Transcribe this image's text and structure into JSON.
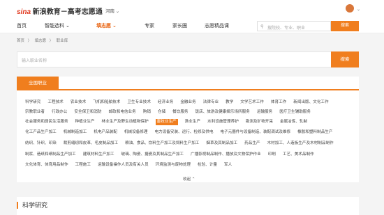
{
  "header": {
    "logo_brand": "sina",
    "logo_text": "新浪教育－高考志愿通",
    "region": "河南 ⌄"
  },
  "nav": {
    "items": [
      "首页",
      "智能选科 ⌄",
      "填志愿 ⌄",
      "专家",
      "家长圈",
      "志愿精品课"
    ],
    "active_index": 2
  },
  "search_mini": {
    "placeholder": "搜院校、专业、职业",
    "button": "搜索"
  },
  "breadcrumb": [
    "首页",
    "〉",
    "填志愿",
    "〉",
    "职业库"
  ],
  "search": {
    "placeholder": "输入职业名称",
    "button": "搜索"
  },
  "tabs": {
    "active": "全国职业"
  },
  "rows": [
    [
      "科学研究",
      "工程技术",
      "农业技术",
      "飞机和船舶技术",
      "卫生专业技术",
      "经济业务",
      "金融业务",
      "法律专业",
      "教学",
      "文学艺术工作",
      "体育工作",
      "新闻出版、文化工作"
    ],
    [
      "宗教职业者",
      "行政办公",
      "安全保卫和消防",
      "邮政和电信业务",
      "购销",
      "仓储",
      "餐饮服务",
      "饭店、旅游及健康娱乐场所服务",
      "运输服务",
      "医疗卫生辅助服务"
    ],
    [
      "社会服务和居民生活服务",
      "种植业生产",
      "林业生产及野生动植物保护",
      "畜牧业生产",
      "渔业生产",
      "水利设施管理养护",
      "勘测及矿物开采",
      "金属冶炼、轧制"
    ],
    [
      "化工产品生产加工",
      "机械制造加工",
      "机电产品装配",
      "机械设备修理",
      "电力设备安装、运行、检修及供电",
      "电子元器件与设备制造、装配调试及维修",
      "橡胶和塑料制品生产"
    ],
    [
      "纺织、针织、印染",
      "裁剪缝纫和皮革、毛皮制品加工",
      "粮油、食品、饮料生产加工及饲料生产加工",
      "烟草及其制品加工",
      "药品生产",
      "木材加工、人造板生产及木材制品制作"
    ],
    [
      "制浆、造纸和纸制品生产加工",
      "建筑材料生产加工",
      "玻璃、陶瓷、搪瓷及其制品生产加工",
      "广播影视制品制作、播放及文物保护作业",
      "印刷",
      "工艺、美术品制作"
    ],
    [
      "文化体育、体育用品制作",
      "工程施工",
      "运输设备操作人员及有关人员",
      "环境监测与废物处理",
      "检验、计量",
      "军人"
    ]
  ],
  "active_chip": "畜牧业生产",
  "collapse_label": "收起 ⌃",
  "section_title": "科学研究",
  "colors": {
    "accent": "#f07e1e",
    "logo_red": "#e0381e"
  }
}
